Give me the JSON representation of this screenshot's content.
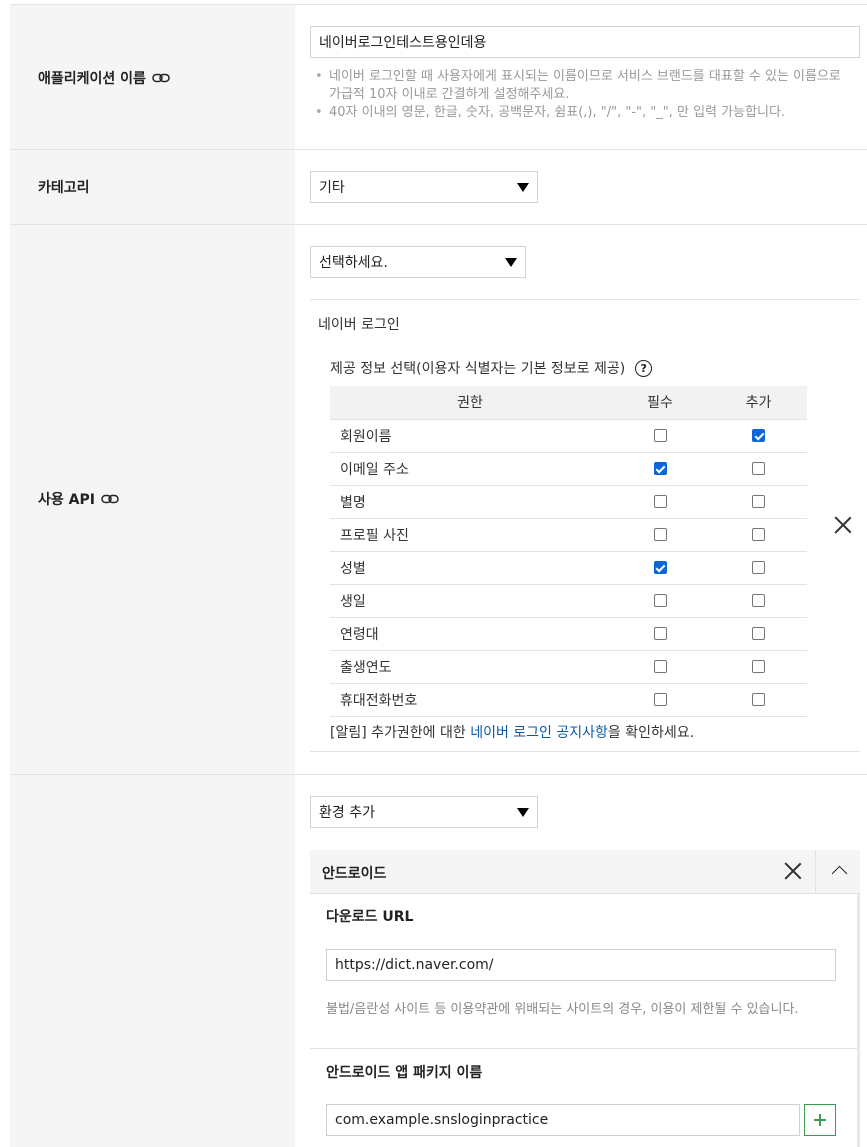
{
  "app_name": {
    "label": "애플리케이션 이름",
    "value": "네이버로그인테스트용인데용",
    "hints": [
      "네이버 로그인할 때 사용자에게 표시되는 이름이므로 서비스 브랜드를 대표할 수 있는 이름으로 가급적 10자 이내로 간결하게 설정해주세요.",
      "40자 이내의 영문, 한글, 숫자, 공백문자, 쉼표(,), \"/\", \"-\", \"_\", 만 입력 가능합니다."
    ]
  },
  "category": {
    "label": "카테고리",
    "selected": "기타"
  },
  "api": {
    "label": "사용 API",
    "select_placeholder": "선택하세요.",
    "panel_title": "네이버 로그인",
    "info_title": "제공 정보 선택(이용자 식별자는 기본 정보로 제공)",
    "columns": [
      "권한",
      "필수",
      "추가"
    ],
    "permissions": [
      {
        "name": "회원이름",
        "required": false,
        "optional": true
      },
      {
        "name": "이메일 주소",
        "required": true,
        "optional": false
      },
      {
        "name": "별명",
        "required": false,
        "optional": false
      },
      {
        "name": "프로필 사진",
        "required": false,
        "optional": false
      },
      {
        "name": "성별",
        "required": true,
        "optional": false
      },
      {
        "name": "생일",
        "required": false,
        "optional": false
      },
      {
        "name": "연령대",
        "required": false,
        "optional": false
      },
      {
        "name": "출생연도",
        "required": false,
        "optional": false
      },
      {
        "name": "휴대전화번호",
        "required": false,
        "optional": false
      }
    ],
    "notice_prefix": "[알림] 추가권한에 대한 ",
    "notice_link": "네이버 로그인 공지사항",
    "notice_suffix": "을 확인하세요."
  },
  "environment": {
    "select_label": "환경 추가",
    "platform": "안드로이드",
    "download_url_label": "다운로드 URL",
    "download_url": "https://dict.naver.com/",
    "download_note": "불법/음란성 사이트 등 이용약관에 위배되는 사이트의 경우, 이용이 제한될 수 있습니다.",
    "package_label": "안드로이드 앱 패키지 이름",
    "package_value": "com.example.snsloginpractice"
  },
  "colors": {
    "checkbox_checked": "#0b67d8",
    "link": "#0b5aa8",
    "plus_button": "#3a9b52",
    "label_bg": "#f5f5f5"
  }
}
